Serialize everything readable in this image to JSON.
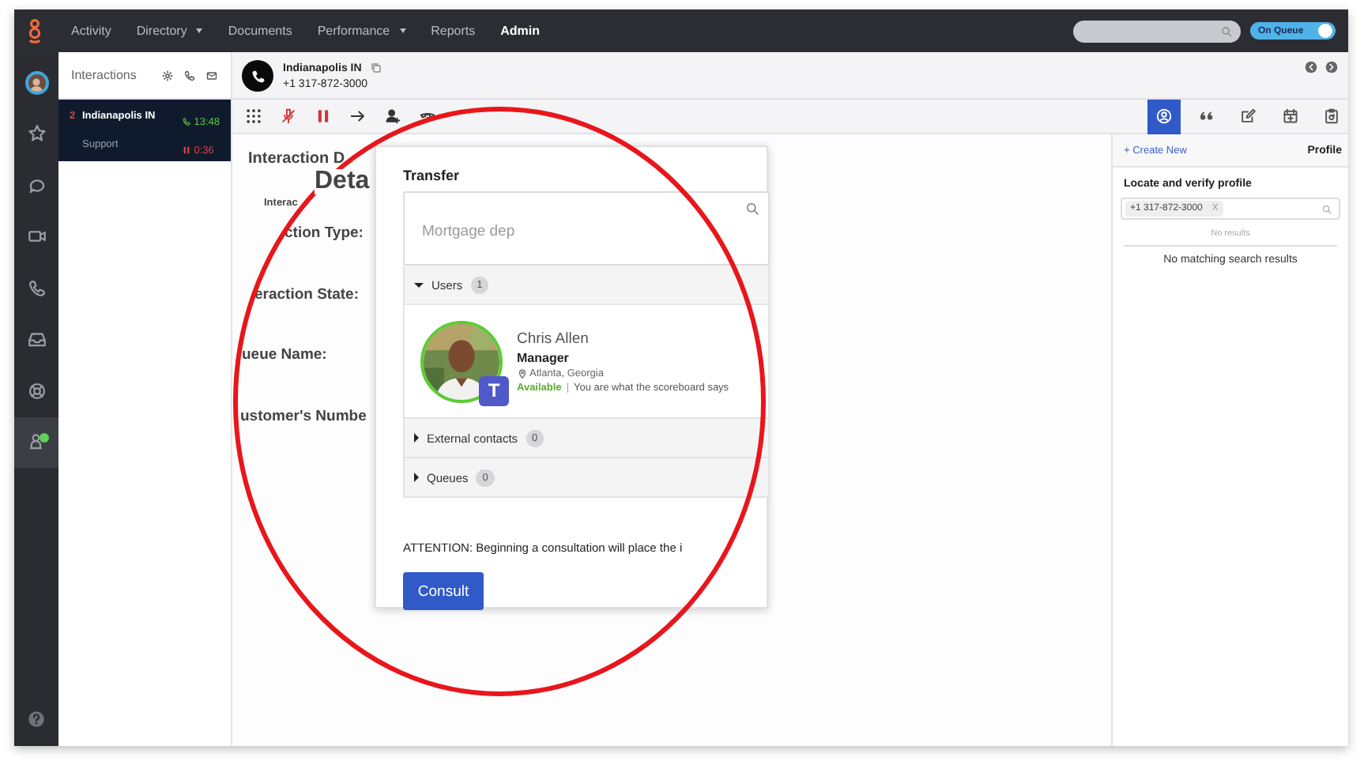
{
  "top_bar": {
    "nav": [
      {
        "label": "Activity",
        "dropdown": false,
        "selected": false
      },
      {
        "label": "Directory",
        "dropdown": true,
        "selected": false
      },
      {
        "label": "Documents",
        "dropdown": false,
        "selected": false
      },
      {
        "label": "Performance",
        "dropdown": true,
        "selected": false
      },
      {
        "label": "Reports",
        "dropdown": false,
        "selected": false
      },
      {
        "label": "Admin",
        "dropdown": false,
        "selected": true
      }
    ],
    "status_toggle": {
      "label": "On Queue",
      "on": true
    }
  },
  "rail_items": [
    {
      "kind": "avatar",
      "selected": false
    },
    {
      "kind": "star",
      "selected": false
    },
    {
      "kind": "chat",
      "selected": false
    },
    {
      "kind": "video",
      "selected": false
    },
    {
      "kind": "phone",
      "selected": false
    },
    {
      "kind": "inbox",
      "selected": false
    },
    {
      "kind": "lifebuoy",
      "selected": false
    },
    {
      "kind": "agent",
      "selected": true
    }
  ],
  "interactions": {
    "title": "Interactions",
    "cards": [
      {
        "count": "2",
        "name": "Indianapolis IN",
        "queue": "Support",
        "talk_time": "13:48",
        "hold_time": "0:36",
        "selected": true
      }
    ]
  },
  "call_header": {
    "name": "Indianapolis IN",
    "number": "+1 317-872-3000"
  },
  "toolbar": [
    {
      "kind": "dialpad",
      "active": false
    },
    {
      "kind": "mute",
      "active": true
    },
    {
      "kind": "hold",
      "active": true
    },
    {
      "kind": "transfer",
      "active": false
    },
    {
      "kind": "add-person",
      "active": false
    },
    {
      "kind": "handset",
      "active": false
    }
  ],
  "details": {
    "title": "Interaction D",
    "overlay_title": "Deta",
    "subtitle": "Interac",
    "labels": [
      "ction Type:",
      "eraction State:",
      "ueue Name:",
      "ustomer's Numbe"
    ]
  },
  "transfer": {
    "title": "Transfer",
    "search": {
      "value": "Mortgage dep"
    },
    "groups": [
      {
        "label": "Users",
        "count": "1",
        "expanded": true,
        "users": [
          {
            "name": "Chris Allen",
            "role": "Manager",
            "location": "Atlanta, Georgia",
            "status": "Available",
            "separator": "|",
            "message": "You are what the scoreboard says",
            "badge": "T"
          }
        ]
      },
      {
        "label": "External contacts",
        "count": "0",
        "expanded": false
      },
      {
        "label": "Queues",
        "count": "0",
        "expanded": false
      }
    ],
    "notice": "ATTENTION: Beginning a consultation will place the i",
    "button": "Consult"
  },
  "right_panel": {
    "tabs": [
      {
        "kind": "profile",
        "selected": true
      },
      {
        "kind": "quote",
        "selected": false
      },
      {
        "kind": "edit",
        "selected": false
      },
      {
        "kind": "calendar",
        "selected": false
      },
      {
        "kind": "clipboard",
        "selected": false
      }
    ],
    "create_link": "+ Create New",
    "title": "Profile",
    "section_title": "Locate and verify profile",
    "chip": "+1 317-872-3000",
    "chip_remove": "X",
    "empty_header": "No results",
    "empty_message": "No matching search results"
  }
}
